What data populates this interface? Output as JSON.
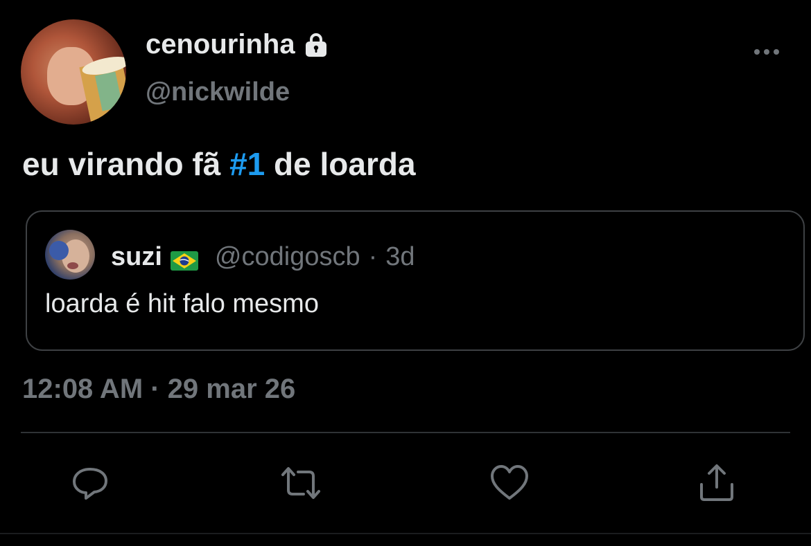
{
  "author": {
    "display_name": "cenourinha",
    "handle": "@nickwilde",
    "protected": true
  },
  "tweet": {
    "text_before": "eu virando fã ",
    "hashtag": "#1",
    "text_after": " de loarda",
    "timestamp": "12:08 AM · 29 mar 26"
  },
  "quoted_tweet": {
    "display_name": "suzi",
    "flag": "Brazil flag",
    "handle": "@codigoscb",
    "separator": "·",
    "age": "3d",
    "text": "loarda é hit falo mesmo"
  },
  "actions": [
    {
      "icon": "reply-icon"
    },
    {
      "icon": "retweet-icon"
    },
    {
      "icon": "like-icon"
    },
    {
      "icon": "share-icon"
    }
  ],
  "colors": {
    "background": "#000000",
    "text_primary": "#e7e9ea",
    "text_secondary": "#71767b",
    "accent": "#1d9bf0",
    "border": "#3e4144"
  }
}
